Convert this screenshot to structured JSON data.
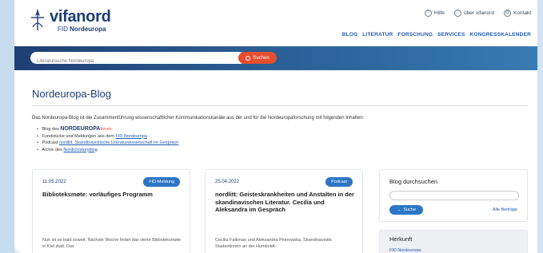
{
  "header": {
    "logo_name": "vifanord",
    "logo_sub_prefix": "FID",
    "logo_sub_bold": "Nordeuropa",
    "util_links": [
      {
        "icon": "help-icon",
        "glyph": "?",
        "label": "Hilfe"
      },
      {
        "icon": "info-icon",
        "glyph": "i",
        "label": "über vifanord"
      },
      {
        "icon": "contact-icon",
        "glyph": "@",
        "label": "Kontakt"
      }
    ],
    "nav": [
      "BLOG",
      "LITERATUR",
      "FORSCHUNG",
      "SERVICES",
      "KONGRESSKALENDER"
    ]
  },
  "search": {
    "placeholder": "Literatursuche Nordeuropa",
    "button_label": "Suchen"
  },
  "page": {
    "title": "Nordeuropa-Blog",
    "intro": "Das Nordeuropa-Blog ist die Zusammenführung wissenschaftlicher Kommunikationskanäle aus der und für die Nordeuropaforschung mit folgenden Inhalten:",
    "bullets": {
      "b1_prefix": "Blog des",
      "b1_emph": "NORDEUROPA",
      "b1_suffix": "forum",
      "b2_prefix": "Fundstücke und Meldungen aus dem",
      "b2_link": "FID Nordeuropa",
      "b3_prefix": "Podcast",
      "b3_link": "nordlitt. Skandinavistische Literaturwissenschaft im Gespräch",
      "b4_prefix": "Archiv des",
      "b4_link": "Nordichistoryblog"
    }
  },
  "cards": [
    {
      "date": "11.05.2022",
      "tag": "FID-Meldung",
      "title": "Biblioteksmøte: vorläufiges Programm",
      "body": "Nun ist es bald soweit: Nächste Woche findet das vierte Biblioteksmøte in Kiel statt. Das"
    },
    {
      "date": "25.04.2022",
      "tag": "Podcast",
      "title": "nordlitt: Geisteskrankheiten und Anstalten in der skandinavischen Literatur. Cecilia und Aleksandra im Gespräch",
      "body": "Cecilia Falkman und Aleksandra Piotrowska, Skandinavistik-Studentinnen an der Humboldt-"
    }
  ],
  "sidebar": {
    "search_title": "Blog durchsuchen",
    "search_button": "Suche",
    "all_posts": "Alle Beiträge",
    "origin_title": "Herkunft",
    "origin_link": "FID Nordeuropa"
  },
  "colors": {
    "brand_navy": "#1d3e74",
    "link_blue": "#1f5bb0",
    "accent_red": "#e64e2e",
    "tag_blue": "#2c76c6"
  }
}
